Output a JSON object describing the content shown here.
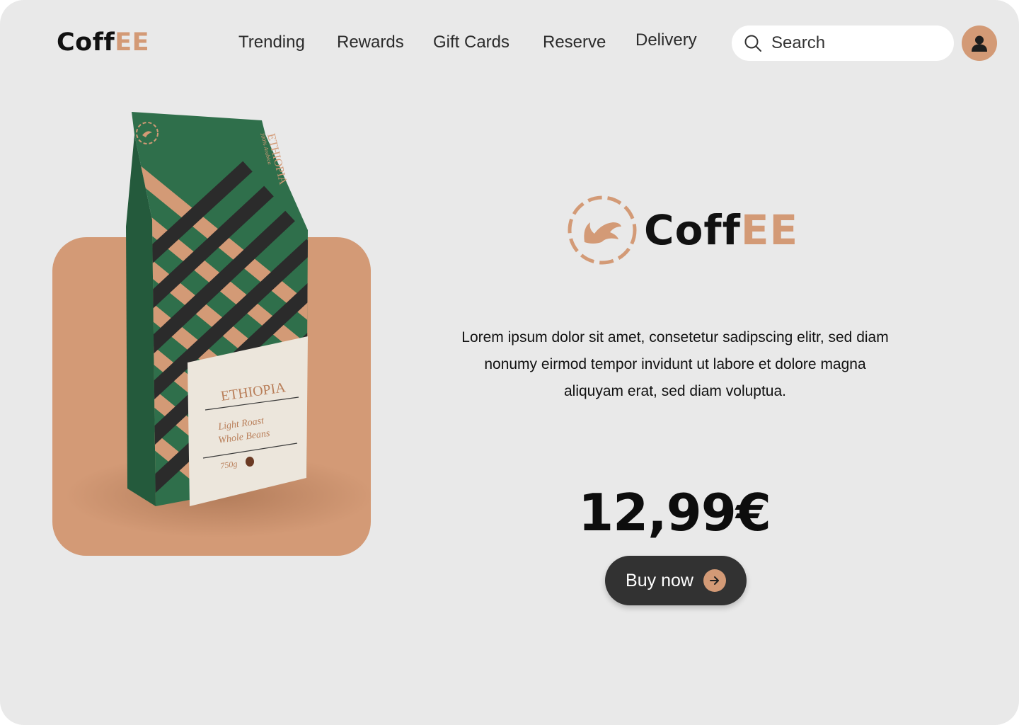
{
  "colors": {
    "accent": "#d39a76",
    "bag_green": "#2f6f4b",
    "dark": "#323232",
    "background": "#e9e9e9"
  },
  "header": {
    "logo_main": "Coff",
    "logo_accent": "EE",
    "nav": [
      "Trending",
      "Rewards",
      "Gift Cards",
      "Reserve",
      "Delivery"
    ],
    "search_placeholder": "Search",
    "icons": {
      "search": "search-icon",
      "avatar": "user-icon"
    }
  },
  "product": {
    "bag": {
      "vertical_label": "ETHIOPIA",
      "vertical_sublabel": "100% Arabica",
      "label_title": "ETHIOPIA",
      "label_line1": "Light Roast",
      "label_line2": "Whole Beans",
      "label_weight": "750g"
    }
  },
  "hero": {
    "brand_main": "Coff",
    "brand_accent": "EE",
    "description": "Lorem ipsum dolor sit amet, consetetur sadipscing elitr, sed diam nonumy eirmod tempor invidunt ut labore et dolore magna aliquyam erat, sed diam voluptua.",
    "price": "12,99€",
    "buy_label": "Buy now",
    "buy_icon": "arrow-right-icon"
  }
}
